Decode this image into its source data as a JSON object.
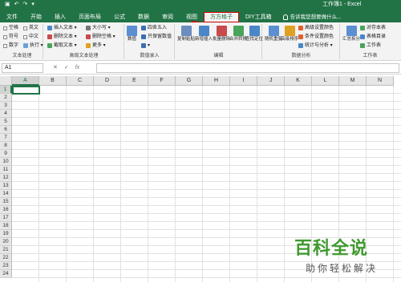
{
  "titlebar": {
    "qat": [
      "▣",
      "↶",
      "↷",
      "▾"
    ],
    "doc_title": "工作簿1 - Excel"
  },
  "tabs": [
    "文件",
    "开始",
    "插入",
    "页面布局",
    "公式",
    "数据",
    "审阅",
    "视图",
    "方方格子",
    "DIY工具箱"
  ],
  "active_tab": "方方格子",
  "tell_me": "告诉我您想要做什么...",
  "ribbon": {
    "text_group": {
      "label": "文本处理",
      "checks": [
        "空格",
        "英文",
        "符号",
        "中文",
        "数字",
        "执行 ▾"
      ]
    },
    "advanced_text_group": {
      "label": "高级文本处理",
      "items": [
        "插入文本 ▾",
        "删除文本 ▾",
        "截取文本 ▾",
        "大小写 ▾",
        "删除空格 ▾",
        "更多 ▾"
      ]
    },
    "numeric_group": {
      "label": "数值录入",
      "big": "数值",
      "items": [
        "四舍五入",
        "只保留数值",
        "▾"
      ]
    },
    "edit_group": {
      "label": "编辑",
      "bigs": [
        "复制粘贴",
        "新增插入",
        "批量删除",
        "合并转换",
        "查找定位"
      ]
    },
    "analysis_group": {
      "label": "数据分析",
      "bigs": [
        "随机重复",
        "高级排序"
      ],
      "items": [
        "高级设置颜色",
        "条件设置颜色",
        "统计与分析 ▾"
      ]
    },
    "sheet_group": {
      "label": "工作表",
      "big": "汇总拆分",
      "items": [
        "对存本表",
        "表格目录",
        "工作表"
      ]
    }
  },
  "formula_bar": {
    "name_box": "A1",
    "tools": [
      "✕",
      "✓",
      "fx"
    ],
    "value": ""
  },
  "grid": {
    "columns": [
      "A",
      "B",
      "C",
      "D",
      "E",
      "F",
      "G",
      "H",
      "I",
      "J",
      "K",
      "L",
      "M",
      "N"
    ],
    "rows": [
      "1",
      "2",
      "3",
      "4",
      "5",
      "6",
      "7",
      "8",
      "9",
      "10",
      "11",
      "12",
      "13",
      "14",
      "15",
      "16",
      "17",
      "18",
      "19",
      "20",
      "21",
      "22",
      "23",
      "24"
    ]
  },
  "watermark": {
    "main": "百科全说",
    "sub": "助你轻松解决"
  },
  "colors": {
    "accent": "#217346",
    "highlight_border": "#cc0000",
    "watermark": "#3f9a2f"
  }
}
